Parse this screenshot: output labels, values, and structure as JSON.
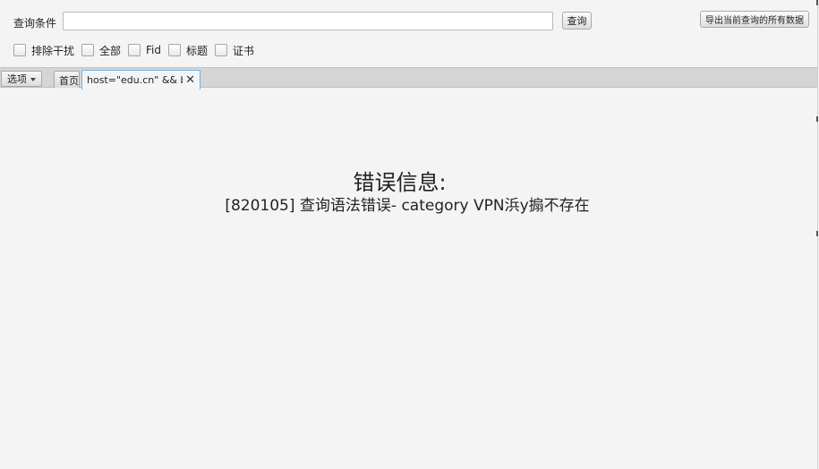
{
  "search": {
    "label": "查询条件",
    "value": "",
    "placeholder": "",
    "search_button": "查询",
    "export_button": "导出当前查询的所有数据"
  },
  "filters": [
    {
      "label": "排除干扰",
      "checked": false
    },
    {
      "label": "全部",
      "checked": false
    },
    {
      "label": "Fid",
      "checked": false
    },
    {
      "label": "标题",
      "checked": false
    },
    {
      "label": "证书",
      "checked": false
    }
  ],
  "tabbar": {
    "options_label": "选项",
    "home_tab": "首页",
    "active_tab": "host=\"edu.cn\" && b..."
  },
  "content": {
    "error_title": "错误信息:",
    "error_message": "[820105] 查询语法错误- category VPN浜у搧不存在"
  }
}
